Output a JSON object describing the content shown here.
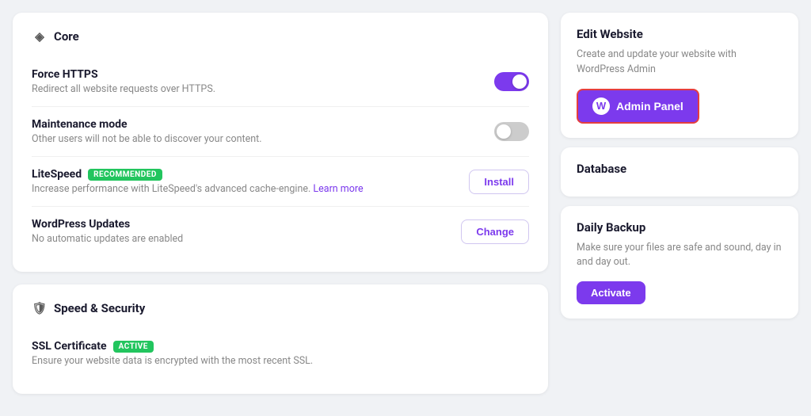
{
  "core_section": {
    "title": "Core",
    "icon": "◈",
    "settings": [
      {
        "id": "force-https",
        "title": "Force HTTPS",
        "description": "Redirect all website requests over HTTPS.",
        "type": "toggle",
        "enabled": true
      },
      {
        "id": "maintenance-mode",
        "title": "Maintenance mode",
        "description": "Other users will not be able to discover your content.",
        "type": "toggle",
        "enabled": false
      },
      {
        "id": "litespeed",
        "title": "LiteSpeed",
        "badge": "RECOMMENDED",
        "badge_type": "recommended",
        "description": "Increase performance with LiteSpeed's advanced cache-engine.",
        "link_text": "Learn more",
        "type": "button",
        "button_label": "Install",
        "button_type": "outline"
      },
      {
        "id": "wordpress-updates",
        "title": "WordPress Updates",
        "description": "No automatic updates are enabled",
        "type": "button",
        "button_label": "Change",
        "button_type": "outline"
      }
    ]
  },
  "speed_security_section": {
    "title": "Speed & Security",
    "icon": "🛡",
    "settings": [
      {
        "id": "ssl-certificate",
        "title": "SSL Certificate",
        "badge": "ACTIVE",
        "badge_type": "active",
        "description": "Ensure your website data is encrypted with the most recent SSL.",
        "type": "none"
      }
    ]
  },
  "sidebar": {
    "edit_website": {
      "title": "Edit Website",
      "description": "Create and update your website with WordPress Admin",
      "button_label": "Admin Panel",
      "button_icon": "W"
    },
    "database": {
      "title": "Database"
    },
    "daily_backup": {
      "title": "Daily Backup",
      "description": "Make sure your files are safe and sound, day in and day out.",
      "button_label": "Activate"
    }
  }
}
